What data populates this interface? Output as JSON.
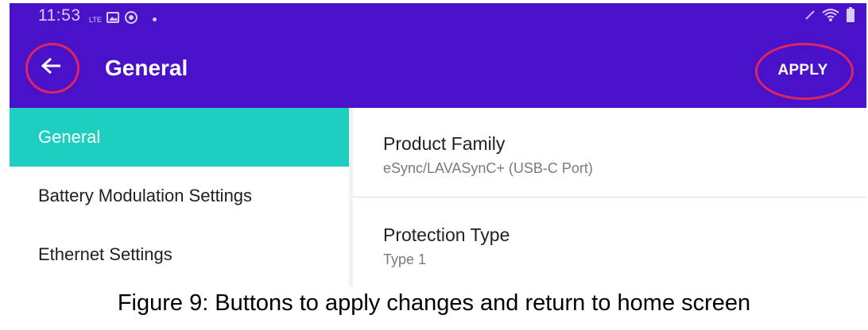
{
  "status_bar": {
    "time": "11:53",
    "network_label": "LTE",
    "icons_left": [
      "lte-icon",
      "image-icon",
      "data-saver-icon",
      "dot-icon"
    ],
    "icons_right": [
      "edit-icon",
      "wifi-icon",
      "battery-icon"
    ]
  },
  "header": {
    "title": "General",
    "apply_label": "APPLY",
    "colors": {
      "background": "#4a12c8",
      "highlight_ring": "#e0245e"
    }
  },
  "sidebar": {
    "items": [
      {
        "label": "General",
        "active": true
      },
      {
        "label": "Battery Modulation Settings",
        "active": false
      },
      {
        "label": "Ethernet Settings",
        "active": false
      }
    ],
    "active_color": "#1ccfc0"
  },
  "settings": [
    {
      "title": "Product Family",
      "value": "eSync/LAVASynC+ (USB-C Port)"
    },
    {
      "title": "Protection Type",
      "value": "Type 1"
    }
  ],
  "caption": "Figure 9: Buttons to apply changes and return to home screen"
}
